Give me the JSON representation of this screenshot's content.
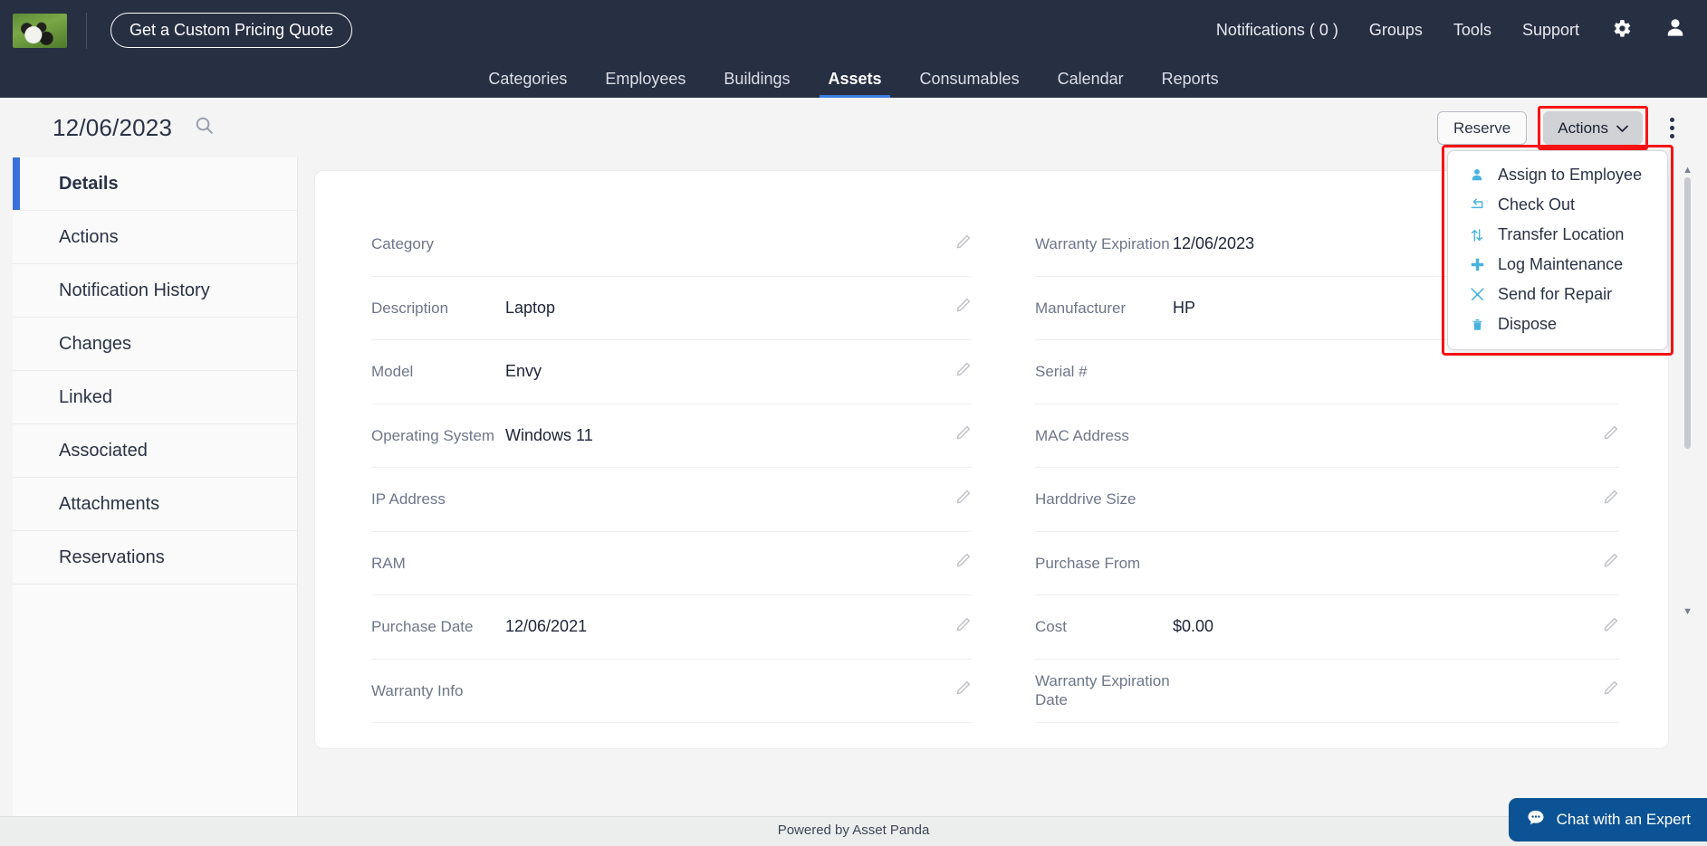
{
  "topbar": {
    "logo_name": "panda-logo",
    "quote_button": "Get a Custom Pricing Quote",
    "links": [
      {
        "label": "Notifications ( 0 )",
        "name": "notifications"
      },
      {
        "label": "Groups",
        "name": "groups"
      },
      {
        "label": "Tools",
        "name": "tools"
      },
      {
        "label": "Support",
        "name": "support"
      }
    ],
    "gear_icon": "gear-icon",
    "user_icon": "user-avatar-icon"
  },
  "nav": {
    "tabs": [
      {
        "label": "Categories",
        "active": false
      },
      {
        "label": "Employees",
        "active": false
      },
      {
        "label": "Buildings",
        "active": false
      },
      {
        "label": "Assets",
        "active": true
      },
      {
        "label": "Consumables",
        "active": false
      },
      {
        "label": "Calendar",
        "active": false
      },
      {
        "label": "Reports",
        "active": false
      }
    ]
  },
  "page_header": {
    "date": "12/06/2023",
    "search_icon": "search-icon",
    "reserve_button": "Reserve",
    "actions_button": "Actions",
    "actions_caret": "chevron-down-icon",
    "kebab_icon": "more-options-icon"
  },
  "actions_menu": {
    "highlighted": true,
    "highlight_color": "#f71414",
    "icon_color": "#49b2e0",
    "items": [
      {
        "label": "Assign to Employee",
        "icon": "person-icon"
      },
      {
        "label": "Check Out",
        "icon": "check-out-arrow-icon"
      },
      {
        "label": "Transfer Location",
        "icon": "transfer-arrows-icon"
      },
      {
        "label": "Log Maintenance",
        "icon": "plus-icon"
      },
      {
        "label": "Send for Repair",
        "icon": "tools-wrench-icon"
      },
      {
        "label": "Dispose",
        "icon": "trash-icon"
      }
    ]
  },
  "sidebar": {
    "items": [
      {
        "label": "Details",
        "active": true
      },
      {
        "label": "Actions",
        "active": false
      },
      {
        "label": "Notification History",
        "active": false
      },
      {
        "label": "Changes",
        "active": false
      },
      {
        "label": "Linked",
        "active": false
      },
      {
        "label": "Associated",
        "active": false
      },
      {
        "label": "Attachments",
        "active": false
      },
      {
        "label": "Reservations",
        "active": false
      }
    ]
  },
  "details": {
    "left_fields": [
      {
        "label": "Category",
        "value": "",
        "editable": true
      },
      {
        "label": "Description",
        "value": "Laptop",
        "editable": true
      },
      {
        "label": "Model",
        "value": "Envy",
        "editable": true
      },
      {
        "label": "Operating System",
        "value": "Windows 11",
        "editable": true
      },
      {
        "label": "IP Address",
        "value": "",
        "editable": true
      },
      {
        "label": "RAM",
        "value": "",
        "editable": true
      },
      {
        "label": "Purchase Date",
        "value": "12/06/2021",
        "editable": true
      },
      {
        "label": "Warranty Info",
        "value": "",
        "editable": true
      }
    ],
    "right_fields": [
      {
        "label": "Warranty Expiration",
        "value": "12/06/2023",
        "editable": true
      },
      {
        "label": "Manufacturer",
        "value": "HP",
        "editable": true
      },
      {
        "label": "Serial #",
        "value": "",
        "editable": true
      },
      {
        "label": "MAC Address",
        "value": "",
        "editable": true
      },
      {
        "label": "Harddrive Size",
        "value": "",
        "editable": true
      },
      {
        "label": "Purchase From",
        "value": "",
        "editable": true
      },
      {
        "label": "Cost",
        "value": "$0.00",
        "editable": true
      },
      {
        "label": "Warranty Expiration Date",
        "value": "",
        "editable": true
      }
    ]
  },
  "footer": {
    "text": "Powered by Asset Panda"
  },
  "chat": {
    "label": "Chat with an Expert",
    "icon": "chat-bubble-icon",
    "color": "#0b5394"
  }
}
